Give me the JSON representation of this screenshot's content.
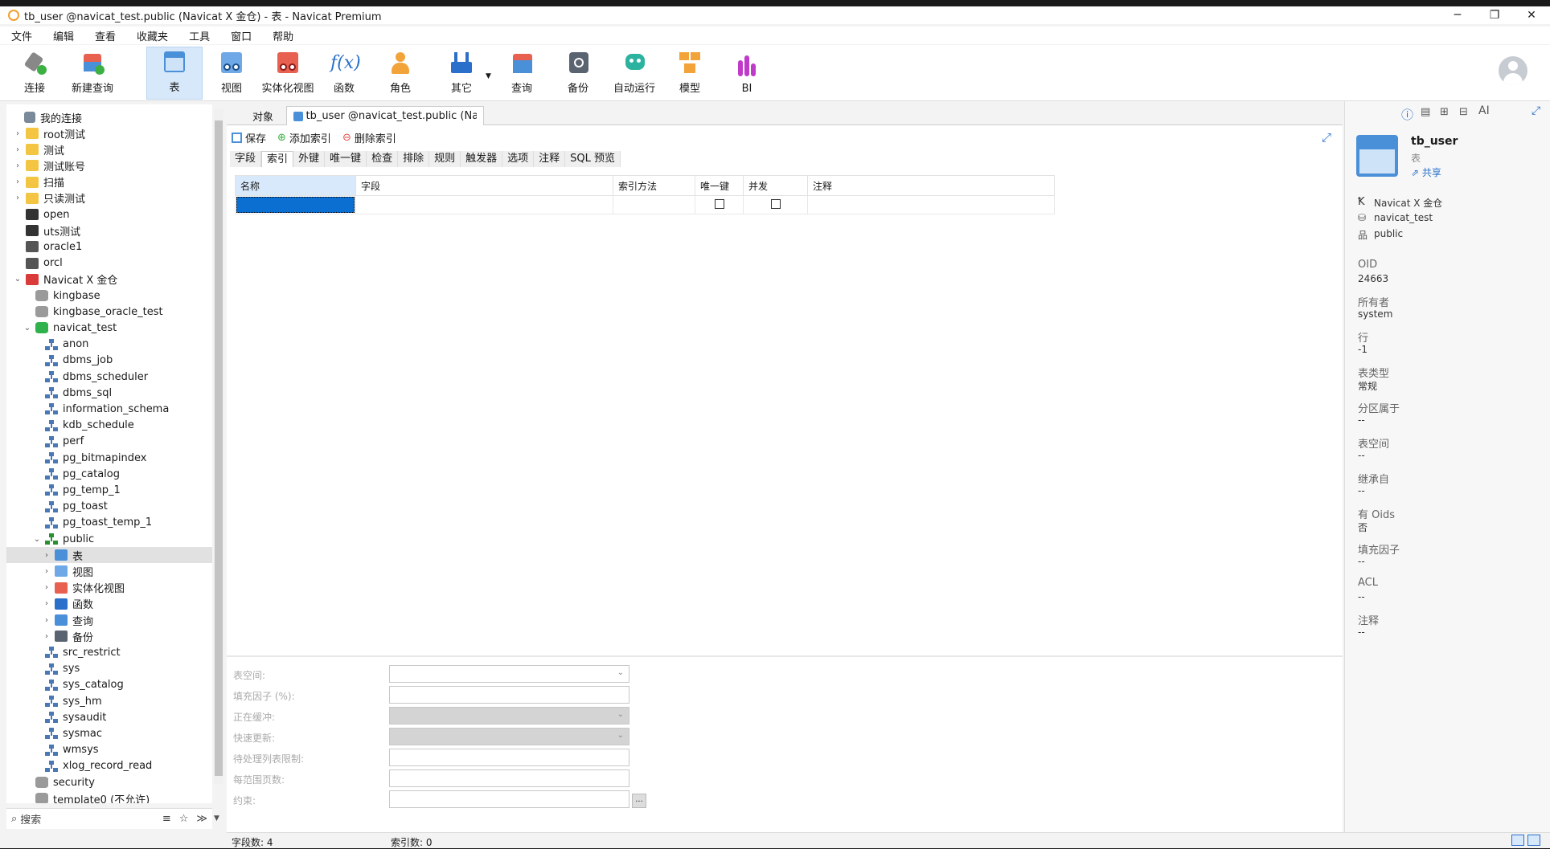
{
  "window": {
    "title": "tb_user @navicat_test.public (Navicat X 金仓) - 表 - Navicat Premium",
    "minimize": "─",
    "restore": "❐",
    "close": "✕"
  },
  "menu": [
    "文件",
    "编辑",
    "查看",
    "收藏夹",
    "工具",
    "窗口",
    "帮助"
  ],
  "toolbar": [
    {
      "label": "连接",
      "icon": "connection-icon"
    },
    {
      "label": "新建查询",
      "icon": "new-query-icon"
    },
    {
      "label": "表",
      "icon": "table-icon",
      "active": true
    },
    {
      "label": "视图",
      "icon": "view-icon"
    },
    {
      "label": "实体化视图",
      "icon": "materialized-view-icon"
    },
    {
      "label": "函数",
      "icon": "function-icon"
    },
    {
      "label": "角色",
      "icon": "role-icon"
    },
    {
      "label": "其它",
      "icon": "other-icon"
    },
    {
      "label": "查询",
      "icon": "query-icon"
    },
    {
      "label": "备份",
      "icon": "backup-icon"
    },
    {
      "label": "自动运行",
      "icon": "automation-icon"
    },
    {
      "label": "模型",
      "icon": "model-icon"
    },
    {
      "label": "BI",
      "icon": "bi-icon"
    }
  ],
  "tree": {
    "header": "我的连接",
    "items": [
      {
        "label": "root测试",
        "icon": "folder",
        "level": 0,
        "arrow": "›"
      },
      {
        "label": "测试",
        "icon": "folder",
        "level": 0,
        "arrow": "›"
      },
      {
        "label": "测试账号",
        "icon": "folder",
        "level": 0,
        "arrow": "›"
      },
      {
        "label": "扫描",
        "icon": "folder",
        "level": 0,
        "arrow": "›"
      },
      {
        "label": "只读测试",
        "icon": "folder",
        "level": 0,
        "arrow": "›"
      },
      {
        "label": "open",
        "icon": "conn",
        "level": 0,
        "arrow": ""
      },
      {
        "label": "uts测试",
        "icon": "conn",
        "level": 0,
        "arrow": ""
      },
      {
        "label": "oracle1",
        "icon": "conn2",
        "level": 0,
        "arrow": ""
      },
      {
        "label": "orcl",
        "icon": "conn2",
        "level": 0,
        "arrow": ""
      },
      {
        "label": "Navicat X 金仓",
        "icon": "kconn",
        "level": 0,
        "arrow": "⌄"
      },
      {
        "label": "kingbase",
        "icon": "db",
        "level": 1,
        "arrow": ""
      },
      {
        "label": "kingbase_oracle_test",
        "icon": "db",
        "level": 1,
        "arrow": ""
      },
      {
        "label": "navicat_test",
        "icon": "dbg",
        "level": 1,
        "arrow": "⌄"
      },
      {
        "label": "anon",
        "icon": "sch",
        "level": 2,
        "arrow": ""
      },
      {
        "label": "dbms_job",
        "icon": "sch",
        "level": 2,
        "arrow": ""
      },
      {
        "label": "dbms_scheduler",
        "icon": "sch",
        "level": 2,
        "arrow": ""
      },
      {
        "label": "dbms_sql",
        "icon": "sch",
        "level": 2,
        "arrow": ""
      },
      {
        "label": "information_schema",
        "icon": "sch",
        "level": 2,
        "arrow": ""
      },
      {
        "label": "kdb_schedule",
        "icon": "sch",
        "level": 2,
        "arrow": ""
      },
      {
        "label": "perf",
        "icon": "sch",
        "level": 2,
        "arrow": ""
      },
      {
        "label": "pg_bitmapindex",
        "icon": "sch",
        "level": 2,
        "arrow": ""
      },
      {
        "label": "pg_catalog",
        "icon": "sch",
        "level": 2,
        "arrow": ""
      },
      {
        "label": "pg_temp_1",
        "icon": "sch",
        "level": 2,
        "arrow": ""
      },
      {
        "label": "pg_toast",
        "icon": "sch",
        "level": 2,
        "arrow": ""
      },
      {
        "label": "pg_toast_temp_1",
        "icon": "sch",
        "level": 2,
        "arrow": ""
      },
      {
        "label": "public",
        "icon": "schg",
        "level": 2,
        "arrow": "⌄"
      },
      {
        "label": "表",
        "icon": "tbl",
        "level": 3,
        "arrow": "›",
        "selected": true
      },
      {
        "label": "视图",
        "icon": "vw",
        "level": 3,
        "arrow": "›"
      },
      {
        "label": "实体化视图",
        "icon": "mv",
        "level": 3,
        "arrow": "›"
      },
      {
        "label": "函数",
        "icon": "fn",
        "level": 3,
        "arrow": "›"
      },
      {
        "label": "查询",
        "icon": "qr",
        "level": 3,
        "arrow": "›"
      },
      {
        "label": "备份",
        "icon": "bk",
        "level": 3,
        "arrow": "›"
      },
      {
        "label": "src_restrict",
        "icon": "sch",
        "level": 2,
        "arrow": ""
      },
      {
        "label": "sys",
        "icon": "sch",
        "level": 2,
        "arrow": ""
      },
      {
        "label": "sys_catalog",
        "icon": "sch",
        "level": 2,
        "arrow": ""
      },
      {
        "label": "sys_hm",
        "icon": "sch",
        "level": 2,
        "arrow": ""
      },
      {
        "label": "sysaudit",
        "icon": "sch",
        "level": 2,
        "arrow": ""
      },
      {
        "label": "sysmac",
        "icon": "sch",
        "level": 2,
        "arrow": ""
      },
      {
        "label": "wmsys",
        "icon": "sch",
        "level": 2,
        "arrow": ""
      },
      {
        "label": "xlog_record_read",
        "icon": "sch",
        "level": 2,
        "arrow": ""
      },
      {
        "label": "security",
        "icon": "db",
        "level": 1,
        "arrow": ""
      },
      {
        "label": "template0 (不允许)",
        "icon": "db",
        "level": 1,
        "arrow": ""
      }
    ],
    "search_placeholder": "搜索"
  },
  "tabs": {
    "objects": "对象",
    "active": "tb_user @navicat_test.public (Navicat..."
  },
  "actions": {
    "save": "保存",
    "add_index": "添加索引",
    "delete_index": "删除索引"
  },
  "subtabs": [
    "字段",
    "索引",
    "外键",
    "唯一键",
    "检查",
    "排除",
    "规则",
    "触发器",
    "选项",
    "注释",
    "SQL 预览"
  ],
  "grid": {
    "headers": [
      "名称",
      "字段",
      "索引方法",
      "唯一键",
      "并发",
      "注释"
    ]
  },
  "props": [
    "表空间:",
    "填充因子 (%):",
    "正在缓冲:",
    "快速更新:",
    "待处理列表限制:",
    "每范围页数:",
    "约束:"
  ],
  "status": {
    "fields": "字段数: 4",
    "indexes": "索引数: 0"
  },
  "info": {
    "name": "tb_user",
    "type": "表",
    "share": "共享",
    "connection": "Navicat X 金仓",
    "database": "navicat_test",
    "schema": "public",
    "fields": [
      {
        "label": "OID",
        "value": "24663"
      },
      {
        "label": "所有者",
        "value": "system"
      },
      {
        "label": "行",
        "value": "-1"
      },
      {
        "label": "表类型",
        "value": "常规"
      },
      {
        "label": "分区属于",
        "value": "--"
      },
      {
        "label": "表空间",
        "value": "--"
      },
      {
        "label": "继承自",
        "value": "--"
      },
      {
        "label": "有 Oids",
        "value": "否"
      },
      {
        "label": "填充因子",
        "value": "--"
      },
      {
        "label": "ACL",
        "value": "--"
      },
      {
        "label": "注释",
        "value": "--"
      }
    ]
  }
}
